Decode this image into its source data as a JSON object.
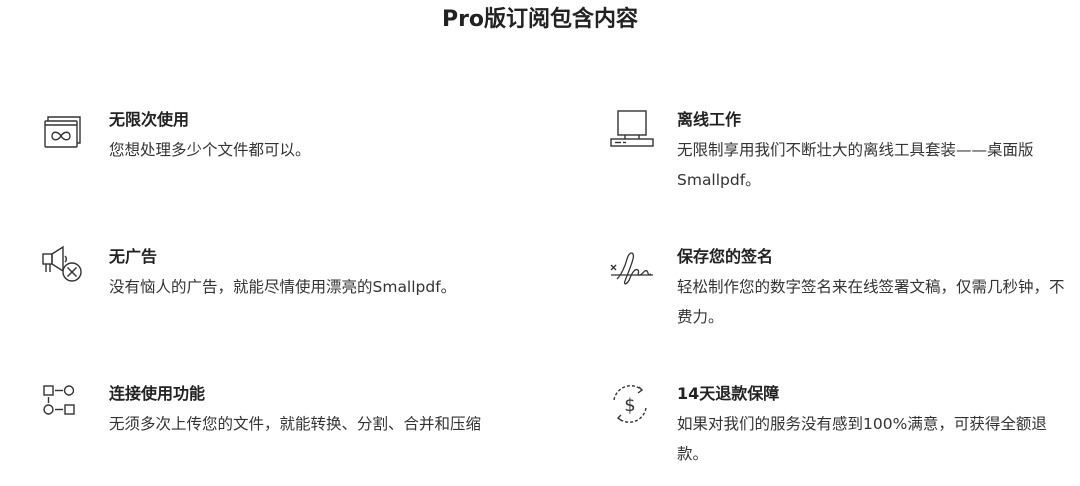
{
  "page": {
    "title": "Pro版订阅包含内容"
  },
  "features": [
    {
      "icon": "infinity-window-icon",
      "title": "无限次使用",
      "desc": "您想处理多少个文件都可以。"
    },
    {
      "icon": "desktop-computer-icon",
      "title": "离线工作",
      "desc": "无限制享用我们不断壮大的离线工具套装——桌面版Smallpdf。"
    },
    {
      "icon": "megaphone-blocked-icon",
      "title": "无广告",
      "desc": "没有恼人的广告，就能尽情使用漂亮的Smallpdf。"
    },
    {
      "icon": "signature-icon",
      "title": "保存您的签名",
      "desc": "轻松制作您的数字签名来在线签署文稿，仅需几秒钟，不费力。"
    },
    {
      "icon": "workflow-connect-icon",
      "title": "连接使用功能",
      "desc": "无须多次上传您的文件，就能转换、分割、合并和压缩"
    },
    {
      "icon": "money-back-icon",
      "title": "14天退款保障",
      "desc": "如果对我们的服务没有感到100%满意，可获得全额退款。"
    }
  ]
}
